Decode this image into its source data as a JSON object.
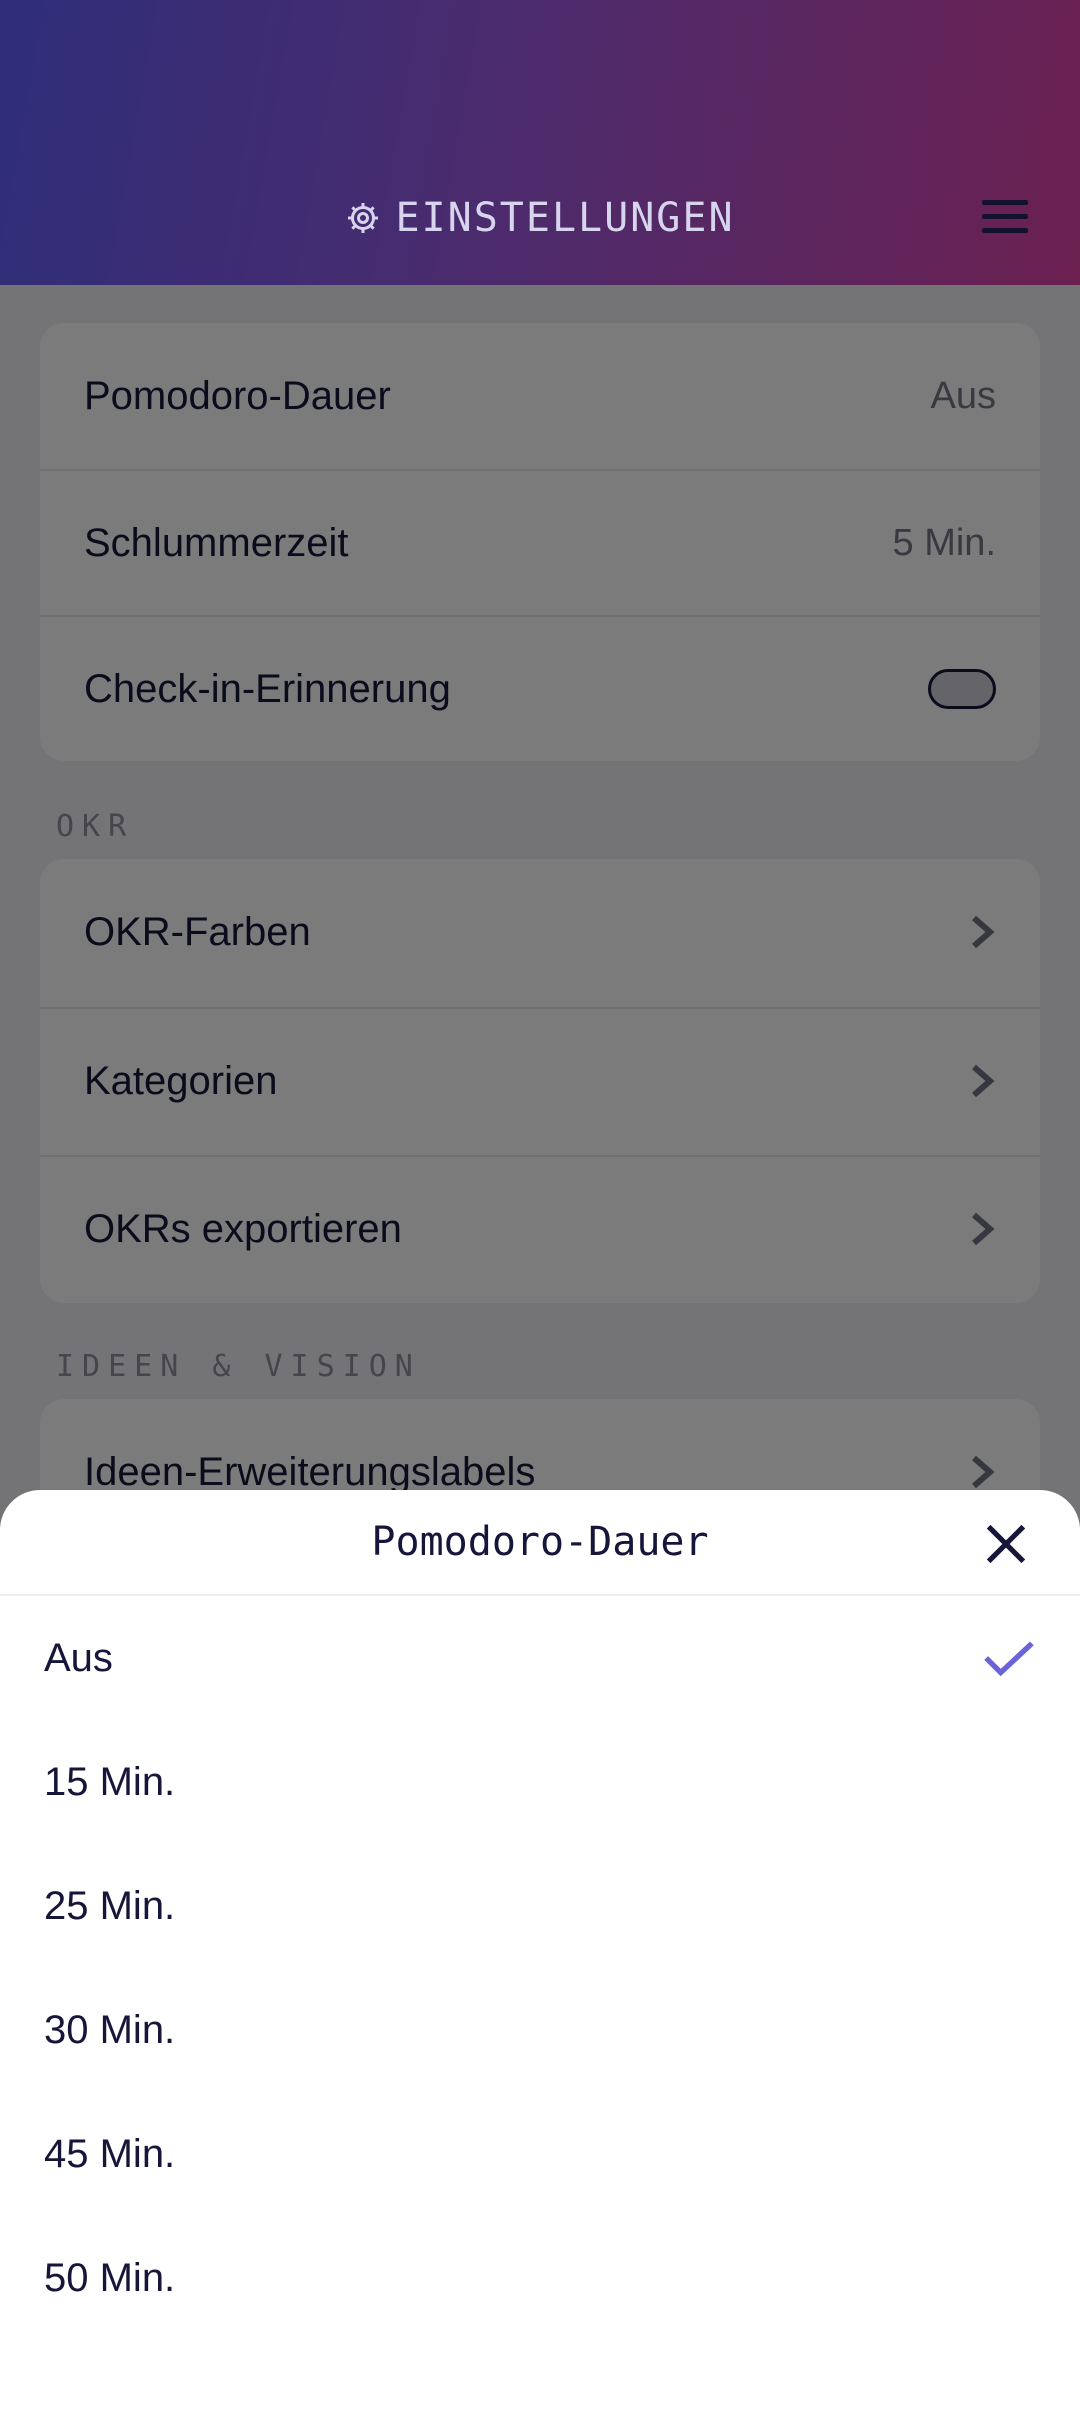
{
  "header": {
    "title": "EINSTELLUNGEN",
    "title_icon": "gear-icon",
    "menu_icon": "hamburger-menu-icon"
  },
  "sections": {
    "timer": {
      "rows": [
        {
          "label": "Pomodoro-Dauer",
          "value": "Aus"
        },
        {
          "label": "Schlummerzeit",
          "value": "5 Min."
        },
        {
          "label": "Check-in-Erinnerung",
          "toggle": false
        }
      ]
    },
    "okr": {
      "label": "OKR",
      "rows": [
        {
          "label": "OKR-Farben"
        },
        {
          "label": "Kategorien"
        },
        {
          "label": "OKRs exportieren"
        }
      ]
    },
    "ideas": {
      "label": "IDEEN & VISION",
      "rows": [
        {
          "label": "Ideen-Erweiterungslabels"
        }
      ]
    }
  },
  "sheet": {
    "title": "Pomodoro-Dauer",
    "options": [
      "Aus",
      "15 Min.",
      "25 Min.",
      "30 Min.",
      "45 Min.",
      "50 Min."
    ],
    "selected": "Aus",
    "accent": "#6a64d8"
  }
}
